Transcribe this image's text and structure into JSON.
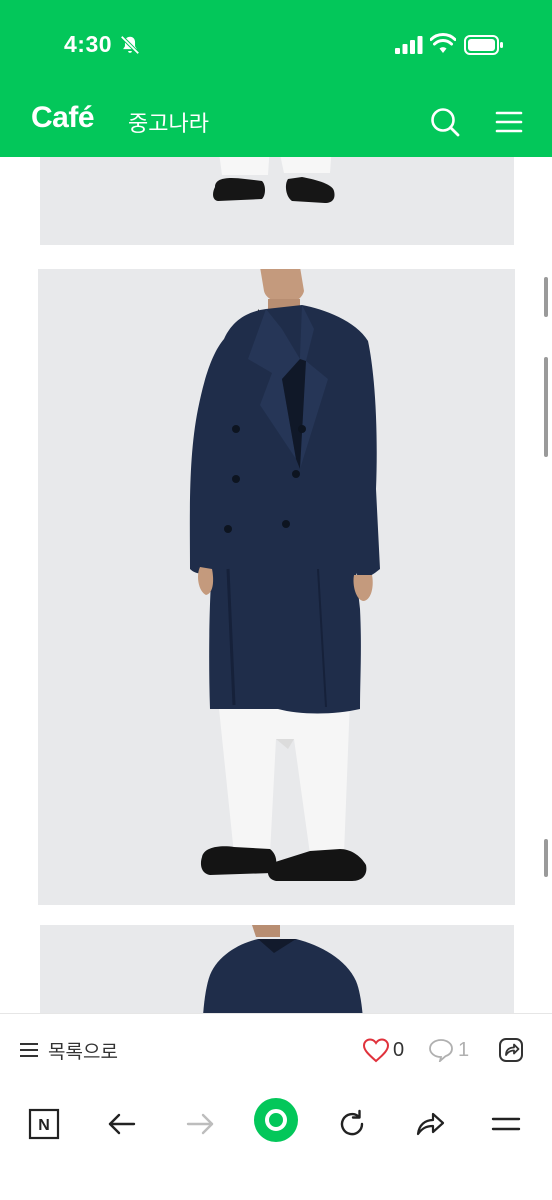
{
  "status_bar": {
    "time": "4:30"
  },
  "app_bar": {
    "logo": "Café",
    "cafe_name": "중고나라"
  },
  "icons": {
    "bell_muted": "bell-slash-icon",
    "signal": "signal-icon",
    "wifi": "wifi-icon",
    "battery": "battery-icon",
    "search": "search-icon",
    "menu": "hamburger-icon",
    "list": "list-icon",
    "like": "heart-icon",
    "comment": "comment-icon",
    "share": "share-icon"
  },
  "article_bar": {
    "list_label": "목록으로",
    "like_count": "0",
    "comment_count": "1"
  },
  "browser_bar": {
    "n_label": "N",
    "buttons": [
      "naver-n-icon",
      "back-arrow-icon",
      "forward-arrow-icon",
      "home-green-icon",
      "reload-icon",
      "share-arrow-icon",
      "menu-icon"
    ]
  },
  "colors": {
    "brand_green": "#03c75a",
    "like_red": "#e0323c",
    "coat_navy": "#1f2d4a",
    "photo_bg": "#e8e9eb"
  }
}
